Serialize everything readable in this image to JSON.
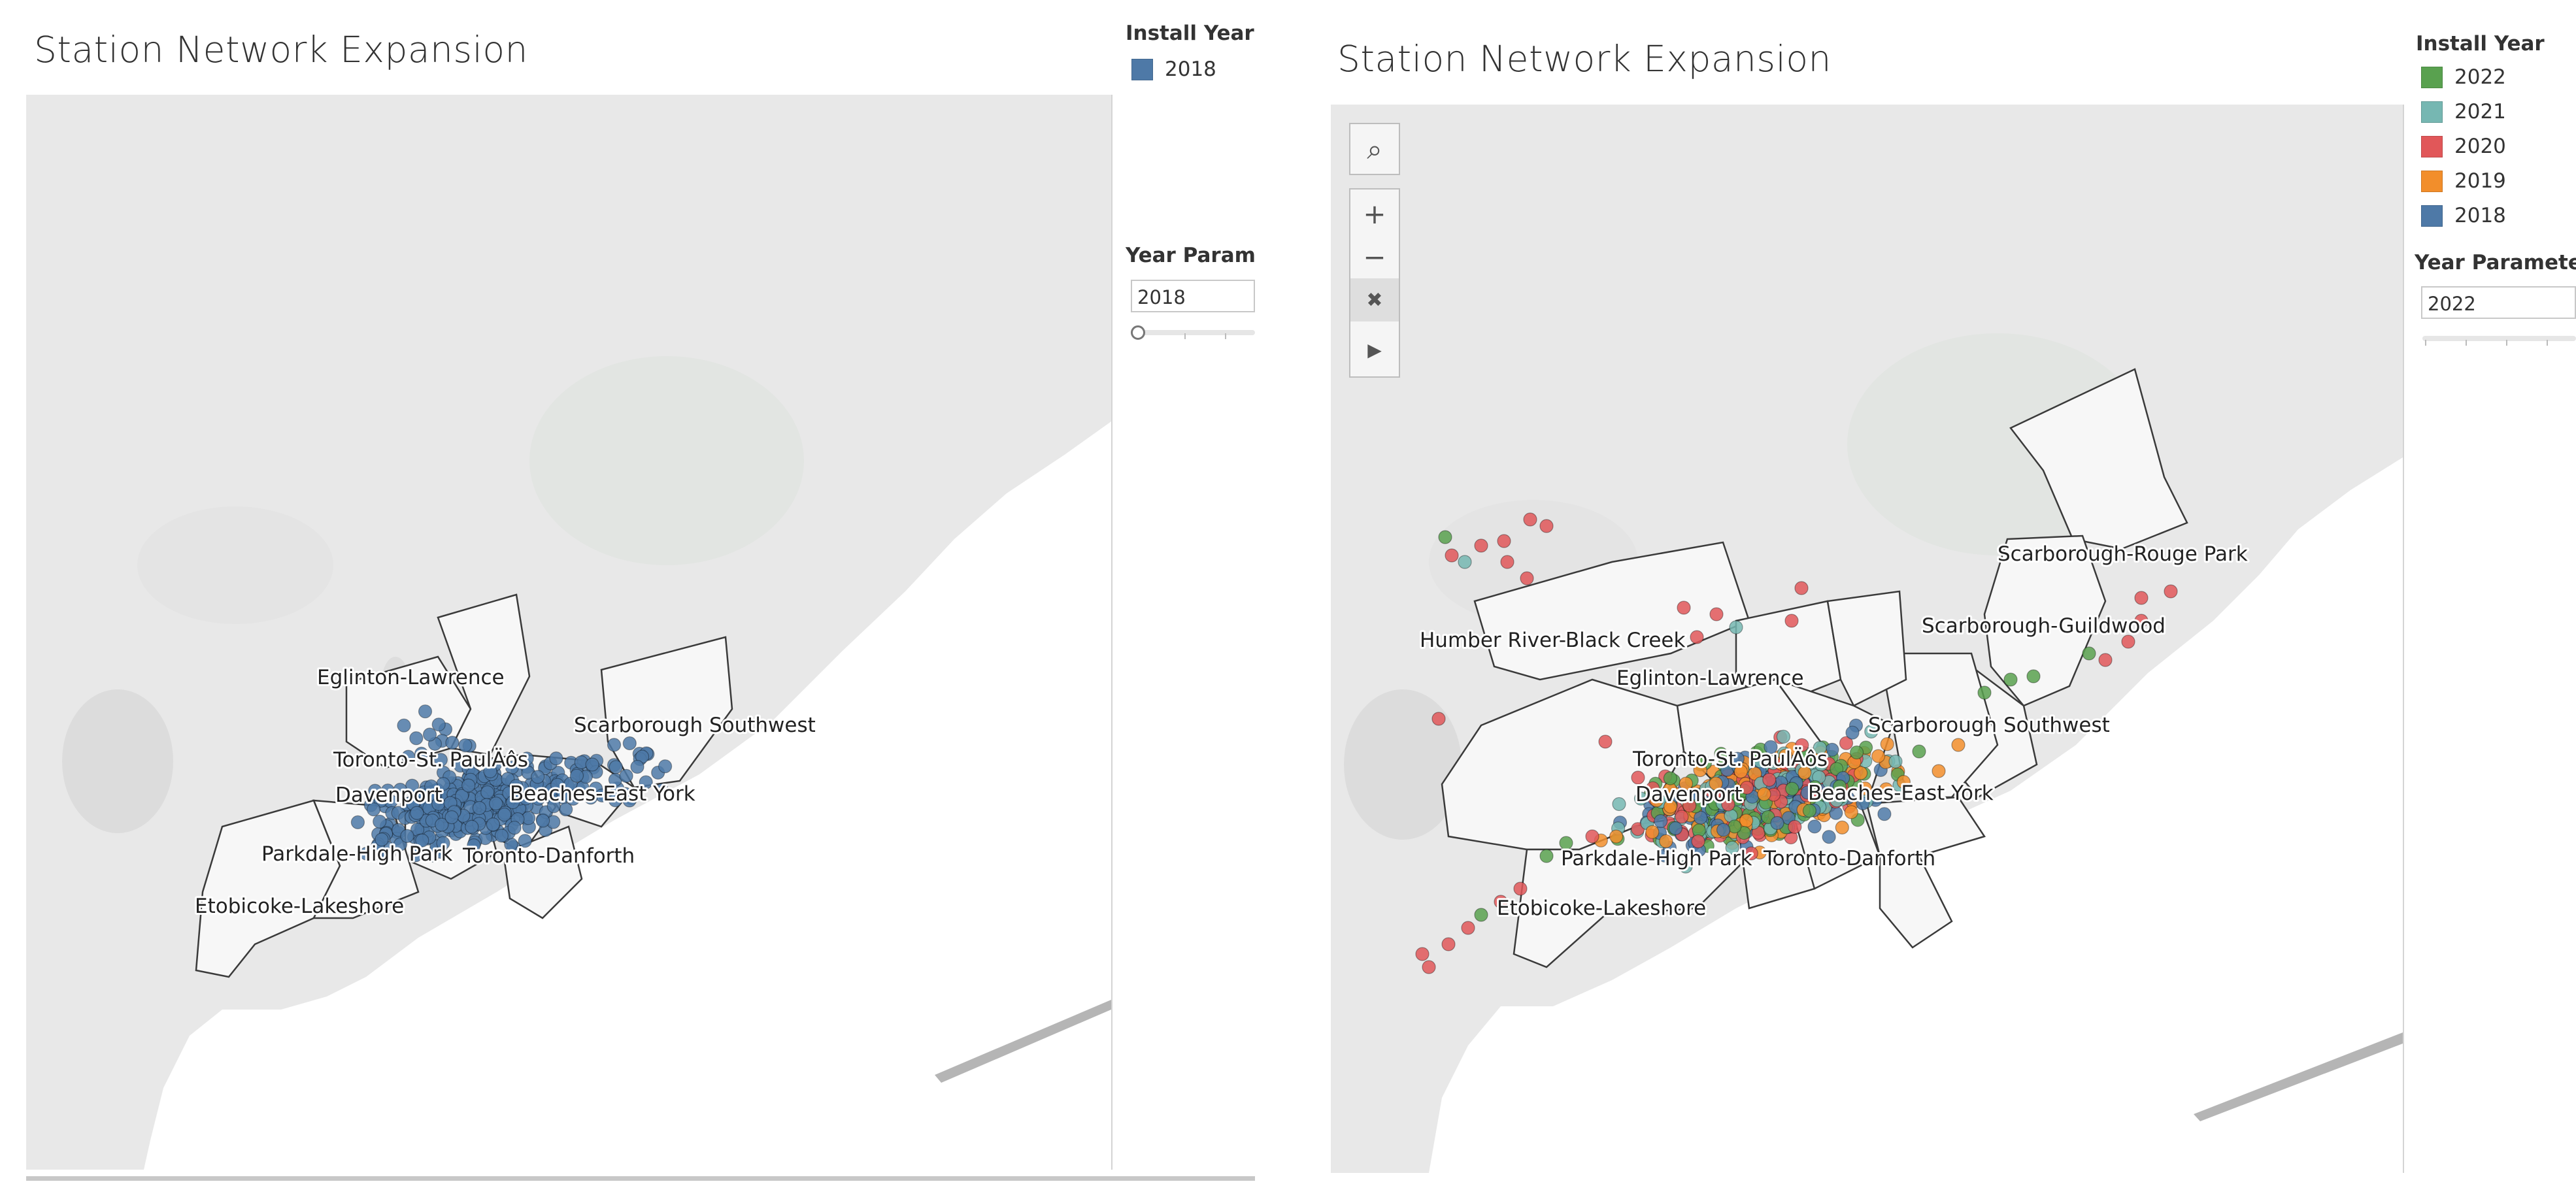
{
  "left": {
    "title": "Station Network Expansion",
    "legend_title": "Install Year",
    "legend": [
      {
        "label": "2018",
        "color": "#4e79a7"
      }
    ],
    "param_title": "Year Parameter",
    "param_value": "2018",
    "slider_level": 0,
    "labels": [
      {
        "text": "Eglinton-Lawrence"
      },
      {
        "text": "Scarborough Southwest"
      },
      {
        "text": "Toronto-St. PaulÄôs"
      },
      {
        "text": "Davenport"
      },
      {
        "text": "Beaches-East York"
      },
      {
        "text": "Parkdale-High Park"
      },
      {
        "text": "Toronto-Danforth"
      },
      {
        "text": "Etobicoke-Lakeshore"
      }
    ]
  },
  "right": {
    "title": "Station Network Expansion",
    "legend_title": "Install Year",
    "legend": [
      {
        "label": "2022",
        "color": "#59a14f"
      },
      {
        "label": "2021",
        "color": "#76b7b2"
      },
      {
        "label": "2020",
        "color": "#e15759"
      },
      {
        "label": "2019",
        "color": "#f28e2b"
      },
      {
        "label": "2018",
        "color": "#4e79a7"
      }
    ],
    "param_title": "Year Parameter",
    "param_value": "2022",
    "slider_level": 1,
    "toolbar": [
      {
        "name": "search-icon",
        "glyph": "⌕"
      },
      {
        "name": "zoom-in-icon",
        "glyph": "+"
      },
      {
        "name": "zoom-out-icon",
        "glyph": "−"
      },
      {
        "name": "unpin-icon",
        "glyph": "✖"
      },
      {
        "name": "play-icon",
        "glyph": "▶"
      }
    ],
    "labels": [
      {
        "text": "Scarborough-Rouge Park"
      },
      {
        "text": "Humber River-Black Creek"
      },
      {
        "text": "Scarborough-Guildwood"
      },
      {
        "text": "Eglinton-Lawrence"
      },
      {
        "text": "Scarborough Southwest"
      },
      {
        "text": "Toronto-St. PaulÄôs"
      },
      {
        "text": "Davenport"
      },
      {
        "text": "Beaches-East York"
      },
      {
        "text": "Parkdale-High Park"
      },
      {
        "text": "Toronto-Danforth"
      },
      {
        "text": "Etobicoke-Lakeshore"
      }
    ]
  }
}
